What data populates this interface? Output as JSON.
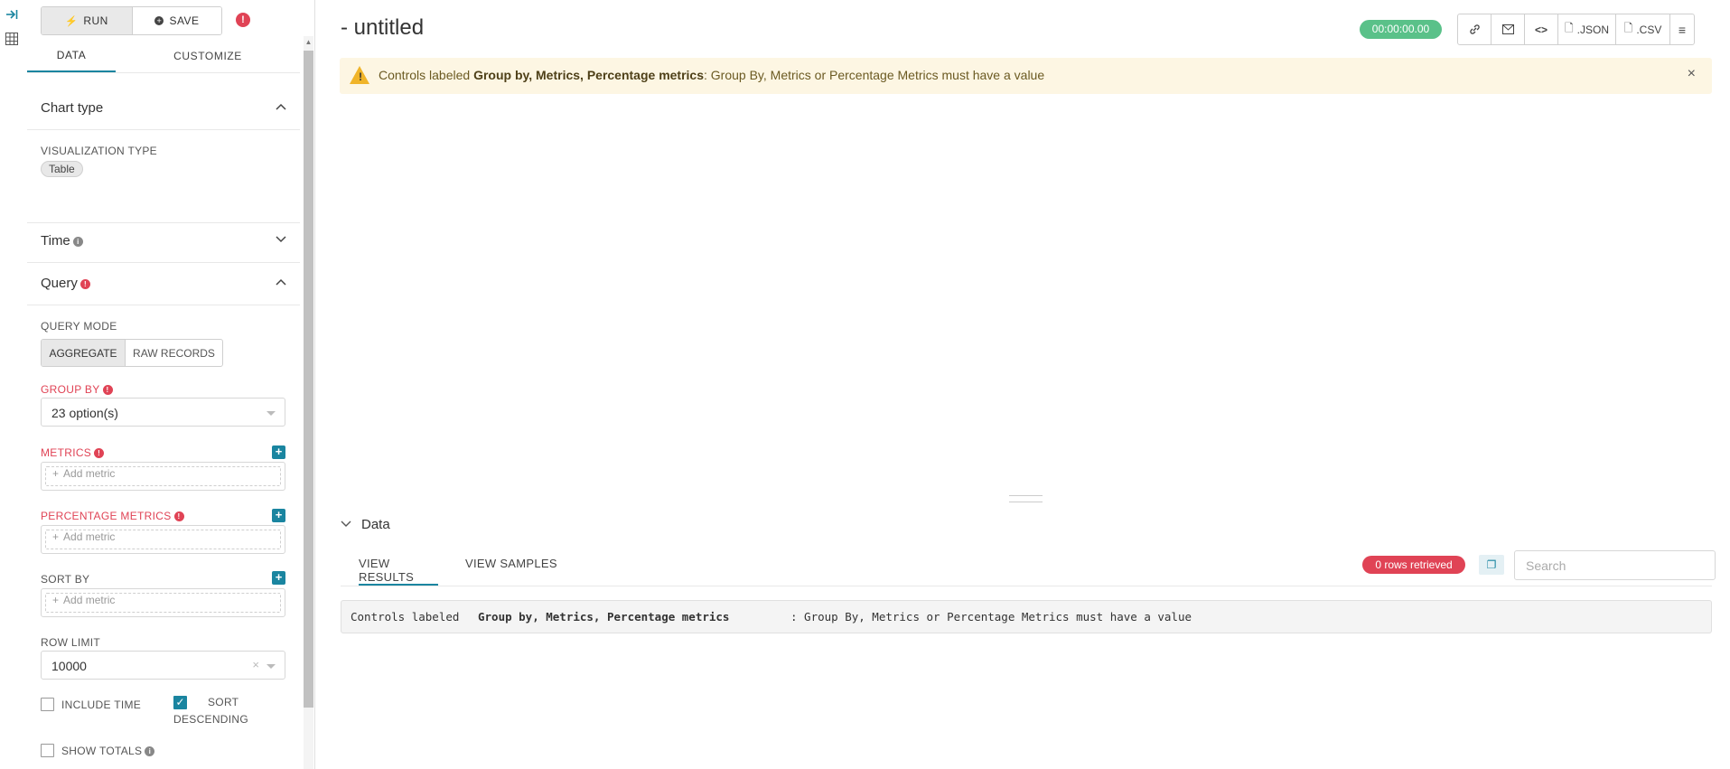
{
  "rail": {
    "collapse_icon": "collapse-icon",
    "dataset_icon": "table-icon"
  },
  "panel": {
    "run_label": "RUN",
    "save_label": "SAVE",
    "tabs": {
      "data": "DATA",
      "customize": "CUSTOMIZE"
    },
    "chart_type": {
      "title": "Chart type",
      "viz_label": "VISUALIZATION TYPE",
      "viz_value": "Table"
    },
    "time": {
      "title": "Time"
    },
    "query": {
      "title": "Query",
      "mode_label": "QUERY MODE",
      "mode_aggregate": "AGGREGATE",
      "mode_raw": "RAW RECORDS",
      "group_by_label": "GROUP BY",
      "group_by_value": "23 option(s)",
      "metrics_label": "METRICS",
      "metrics_placeholder": "Add metric",
      "pct_metrics_label": "PERCENTAGE METRICS",
      "pct_metrics_placeholder": "Add metric",
      "sort_by_label": "SORT BY",
      "sort_by_placeholder": "Add metric",
      "row_limit_label": "ROW LIMIT",
      "row_limit_value": "10000",
      "include_time_label": "INCLUDE TIME",
      "include_time_checked": false,
      "sort_desc_label_1": "SORT",
      "sort_desc_label_2": "DESCENDING",
      "sort_desc_checked": true,
      "show_totals_label": "SHOW TOTALS",
      "show_totals_checked": false
    }
  },
  "header": {
    "title": "- untitled",
    "timer": "00:00:00.00",
    "toolbar": {
      "json": ".JSON",
      "csv": ".CSV"
    }
  },
  "alert": {
    "prefix": "Controls labeled ",
    "bold": "Group by, Metrics, Percentage metrics",
    "suffix": ": Group By, Metrics or Percentage Metrics must have a value"
  },
  "data_pane": {
    "title": "Data",
    "tab_results": "VIEW RESULTS",
    "tab_samples": "VIEW SAMPLES",
    "rows_badge": "0 rows retrieved",
    "search_placeholder": "Search",
    "msg_prefix": "Controls labeled ",
    "msg_bold": "Group by, Metrics, Percentage metrics",
    "msg_suffix": ": Group By, Metrics or Percentage Metrics must have a value"
  },
  "colors": {
    "accent": "#1a85a0",
    "error": "#e04355",
    "success": "#5ac189",
    "warning_bg": "#fdf6e3"
  }
}
